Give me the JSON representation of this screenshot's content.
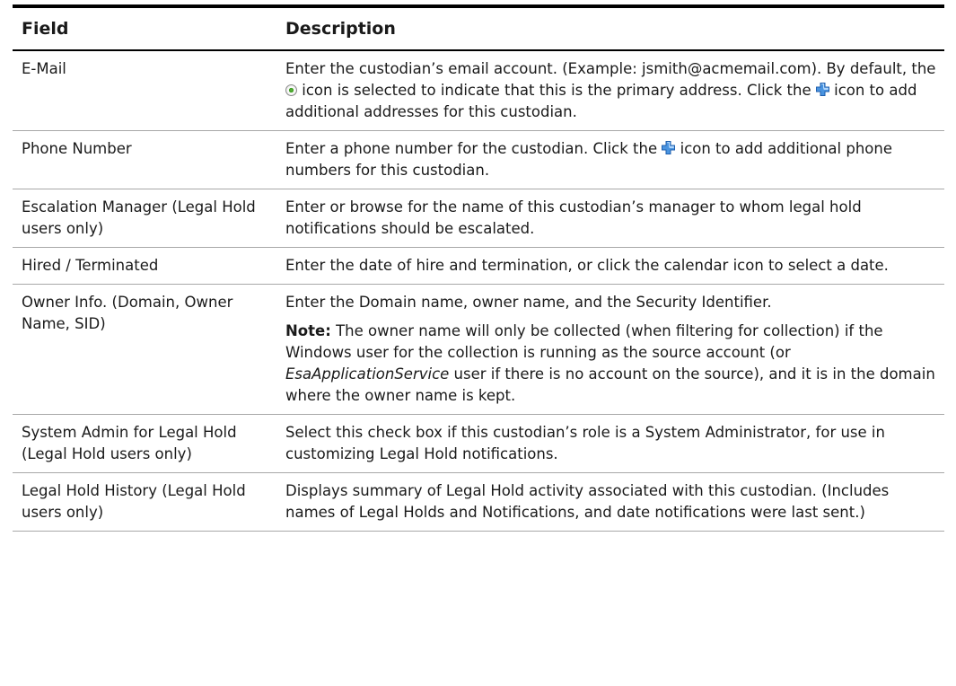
{
  "table": {
    "header": {
      "field": "Field",
      "description": "Description"
    },
    "rows": [
      {
        "field": "E-Mail",
        "desc": {
          "part1": "Enter the custodian’s email account. (Example: jsmith@acmemail.com). By default, the ",
          "part2": " icon is selected to indicate that this is the primary address. Click the ",
          "part3": " icon to add additional addresses for this custodian."
        }
      },
      {
        "field": "Phone Number",
        "desc": {
          "part1": "Enter a phone number for the custodian. Click the ",
          "part2": " icon to add additional phone numbers for this custodian."
        }
      },
      {
        "field": "Escalation Manager (Legal Hold users only)",
        "desc": "Enter or browse for the name of this custodian’s manager to whom legal hold notifications should be escalated."
      },
      {
        "field": "Hired / Terminated",
        "desc": "Enter the date of hire and termination, or click the calendar icon to select a date."
      },
      {
        "field": "Owner Info. (Domain, Owner Name, SID)",
        "desc": {
          "main": "Enter the Domain name, owner name, and the Security Identifier.",
          "note_label": "Note:",
          "note_part1": "  The owner name will only be collected (when filtering for collection) if the Windows user for the collection is running as the source account (or ",
          "note_italic": "EsaApplicationService",
          "note_part2": " user if there is no account on the source), and it is in the domain where the owner name is kept."
        }
      },
      {
        "field_line1": "System Admin for Legal Hold",
        "field_line2": "(Legal Hold users only)",
        "desc": "Select this check box if this custodian’s role is a System Administrator, for use in customizing Legal Hold notifications."
      },
      {
        "field": "Legal Hold History (Legal Hold users only)",
        "desc": "Displays summary of Legal Hold activity associated with this custodian. (Includes names of Legal Holds and Notifications, and date notifications were last sent.)"
      }
    ]
  },
  "icons": {
    "primary_radio": "radio-selected-icon",
    "add": "plus-icon",
    "plus_color": "#3a86d8"
  }
}
